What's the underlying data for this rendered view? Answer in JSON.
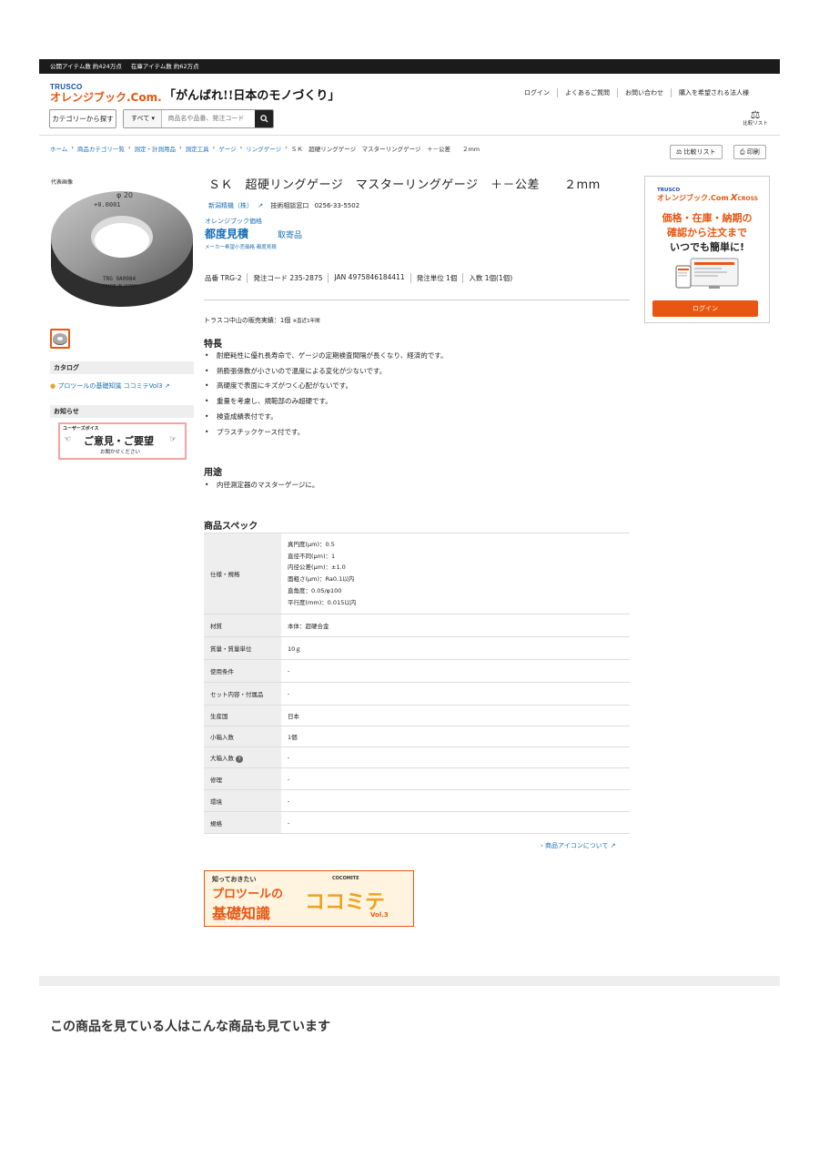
{
  "topbar": {
    "public_items": "公開アイテム数 約424万点",
    "stock_items": "在庫アイテム数 約62万点"
  },
  "header": {
    "logo_trusco": "TRUSCO",
    "logo_orange": "オレンジブック.Com.",
    "tagline": "「がんばれ!!日本のモノづくり」",
    "nav": [
      "ログイン",
      "よくあるご質問",
      "お問い合わせ",
      "購入を希望される法人様"
    ],
    "category_button": "カテゴリーから探す",
    "search_scope": "すべて",
    "search_placeholder": "商品名や品番、発注コード",
    "compare_label": "比較リスト"
  },
  "breadcrumb": [
    "ホーム",
    "商品カテゴリ一覧",
    "測定・計測用品",
    "測定工具",
    "ゲージ",
    "リングゲージ",
    "ＳＫ　超硬リングゲージ　マスターリングゲージ　＋－公差　　２mm"
  ],
  "actions": {
    "compare": "比較リスト",
    "print": "印刷"
  },
  "left": {
    "rep_image_label": "代表画像",
    "ring_text_top": "φ 20",
    "ring_text_tol": "+0.0001",
    "ring_text_serial": "TRG 9A0984",
    "ring_text_made": "MADE IN JAPAN",
    "catalog_heading": "カタログ",
    "catalog_link": "プロツールの基礎知識 ココミテVol3",
    "notice_heading": "お知らせ",
    "voice_small": "ユーザーズボイス",
    "voice_main": "ご意見・ご要望",
    "voice_sub": "お聞かせください"
  },
  "product": {
    "title": "ＳＫ　超硬リングゲージ　マスターリングゲージ　＋－公差　　２mm",
    "maker": "新潟精機（株）",
    "support_label": "技術相談窓口",
    "support_phone": "0256-33-5502",
    "price_label": "オレンジブック価格",
    "price": "都度見積",
    "availability": "取寄品",
    "price_note": "メーカー希望小売価格 都度見積",
    "codes": [
      "品番 TRG-2",
      "発注コード 235-2875",
      "JAN 4975846184411",
      "発注単位 1個",
      "入数 1個(1個)"
    ],
    "sales_text": "トラスコ中山の販売実績：1個",
    "sales_note": "※直近1年間"
  },
  "features": {
    "heading": "特長",
    "items": [
      "耐磨耗性に優れ長寿命で、ゲージの定期検査間隔が長くなり、経済的です。",
      "熱膨張係数が小さいので温度による変化が少ないです。",
      "高硬度で表面にキズがつく心配がないです。",
      "重量を考慮し、規範部のみ超硬です。",
      "検査成績表付です。",
      "プラスチックケース付です。"
    ]
  },
  "usage": {
    "heading": "用途",
    "items": [
      "内径測定器のマスターゲージに。"
    ]
  },
  "spec": {
    "heading": "商品スペック",
    "spec_key": "仕様・規格",
    "spec_lines": [
      "真円度(μm)：0.5",
      "直径不同(μm)：1",
      "内径公差(μm)：±1.0",
      "面粗さ(μm)：Ra0.1以内",
      "直角度：0.05/φ100",
      "平行度(mm)：0.015以内"
    ],
    "rows": [
      {
        "k": "材質",
        "v": "本体：超硬合金"
      },
      {
        "k": "質量・質量単位",
        "v": "10ｇ"
      },
      {
        "k": "使用条件",
        "v": "-"
      },
      {
        "k": "セット内容・付属品",
        "v": "-"
      },
      {
        "k": "生産国",
        "v": "日本"
      },
      {
        "k": "小箱入数",
        "v": "1個"
      },
      {
        "k": "大箱入数",
        "v": "-"
      },
      {
        "k": "修理",
        "v": "-"
      },
      {
        "k": "環境",
        "v": "-"
      },
      {
        "k": "規格",
        "v": "-"
      }
    ],
    "icon_link": "商品アイコンについて"
  },
  "banner": {
    "line1": "知っておきたい",
    "line2": "プロツールの",
    "line3": "基礎知識",
    "brand": "ココミテ",
    "cocomite": "COCOMITE",
    "vol": "Vol.3"
  },
  "ad": {
    "trusco": "TRUSCO",
    "brand": "オレンジブック.Com",
    "x": "X",
    "cross": "CROSS",
    "line1": "価格・在庫・納期の",
    "line2": "確認から注文まで",
    "line3": "いつでも簡単に!",
    "login": "ログイン"
  },
  "recommend_heading": "この商品を見ている人はこんな商品も見ています",
  "colors": {
    "orange": "#e85712",
    "blue": "#1a6fb5",
    "dark": "#1b1b1b"
  }
}
